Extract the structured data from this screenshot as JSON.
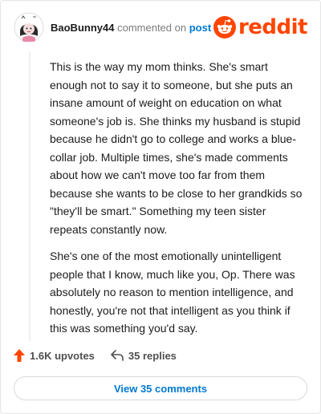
{
  "comment": {
    "username": "BaoBunny44",
    "action_text": "commented on",
    "post_link": "post",
    "paragraphs": [
      "This is the way my mom thinks. She's smart enough not to say it to someone, but she puts an insane amount of weight on education on what someone's job is. She thinks my husband is stupid because he didn't go to college and works a blue-collar job. Multiple times, she's made comments about how we can't move too far from them because she wants to be close to her grandkids so \"they'll be smart.\" Something my teen sister repeats constantly now.",
      "She's one of the most emotionally unintelligent people that I know, much like you, Op. There was absolutely no reason to mention intelligence, and honestly, you're not that intelligent as you think if this was something you'd say."
    ]
  },
  "brand": {
    "wordmark": "reddit",
    "color": "#ff4500"
  },
  "actions": {
    "upvotes": "1.6K upvotes",
    "replies": "35 replies"
  },
  "view_button": {
    "label": "View 35 comments"
  },
  "icons": {
    "upvote": "upvote-arrow-icon",
    "reply": "reply-arrow-icon",
    "logo": "reddit-snoo-icon"
  }
}
